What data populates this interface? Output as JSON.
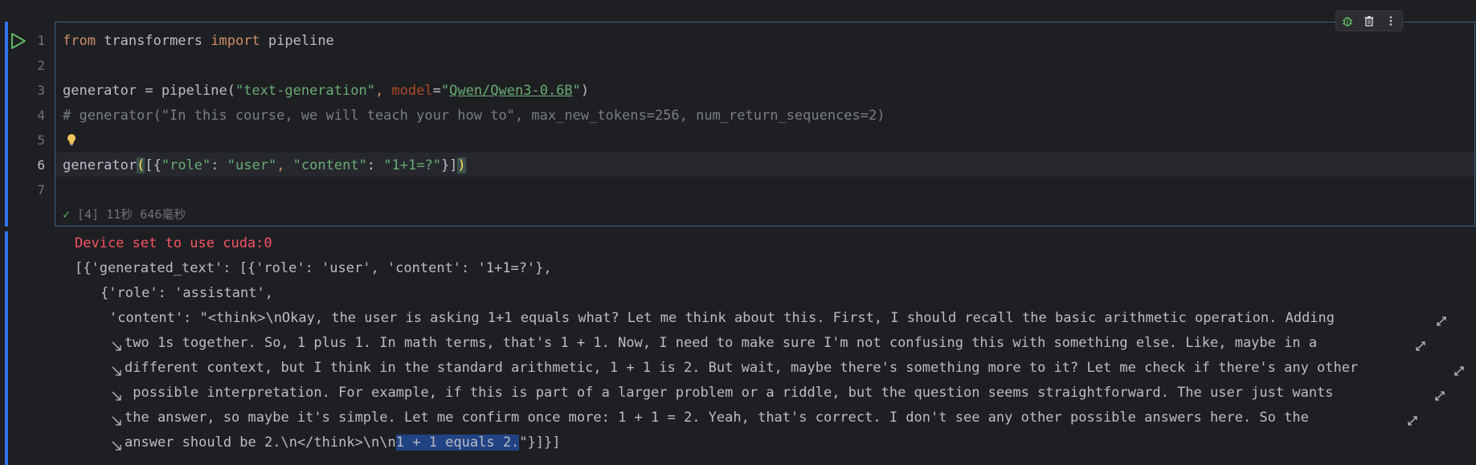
{
  "toolbar": {
    "icons": [
      "debug-icon",
      "trash-icon",
      "more-vertical-icon"
    ]
  },
  "line_numbers": [
    "1",
    "2",
    "3",
    "4",
    "5",
    "6",
    "7"
  ],
  "code": {
    "line1": {
      "kw1": "from",
      "mod": " transformers ",
      "kw2": "import",
      "rest": " pipeline"
    },
    "line3": {
      "a": "generator = pipeline(",
      "s1": "\"text-generation\"",
      "comma": ", ",
      "param": "model",
      "eq": "=",
      "q1": "\"",
      "link": "Qwen/Qwen3-0.6B",
      "q2": "\"",
      "close": ")"
    },
    "line4": "# generator(\"In this course, we will teach your how to\", max_new_tokens=256, num_return_sequences=2)",
    "line6": {
      "a": "generator",
      "p1": "(",
      "b1": "[{",
      "s1": "\"role\"",
      "c1": ": ",
      "s2": "\"user\"",
      "c2": ", ",
      "s3": "\"content\"",
      "c3": ": ",
      "s4": "\"1+1=?\"",
      "b2": "}]",
      "p2": ")"
    }
  },
  "status": {
    "check": "✓",
    "text": " [4] 11秒 646毫秒"
  },
  "output": {
    "warning": "Device set to use cuda:0",
    "line1": "[{'generated_text': [{'role': 'user', 'content': '1+1=?'},",
    "line2": "{'role': 'assistant',",
    "line3": "'content': \"<think>\\nOkay, the user is asking 1+1 equals what? Let me think about this. First, I should recall the basic arithmetic operation. Adding",
    "line4": "two 1s together. So, 1 plus 1. In math terms, that's 1 + 1. Now, I need to make sure I'm not confusing this with something else. Like, maybe in a",
    "line5": "different context, but I think in the standard arithmetic, 1 + 1 is 2. But wait, maybe there's something more to it? Let me check if there's any other",
    "line6": " possible interpretation. For example, if this is part of a larger problem or a riddle, but the question seems straightforward. The user just wants",
    "line7": "the answer, so maybe it's simple. Let me confirm once more: 1 + 1 = 2. Yeah, that's correct. I don't see any other possible answers here. So the",
    "line8a": "answer should be 2.\\n</think>\\n\\n",
    "line8sel": "1 + 1 equals 2.",
    "line8b": "\"}]}]"
  },
  "colors": {
    "accent": "#3574f0",
    "keyword": "#cf8e6d",
    "string": "#6aab73",
    "error": "#f75464",
    "selection": "#214283"
  }
}
